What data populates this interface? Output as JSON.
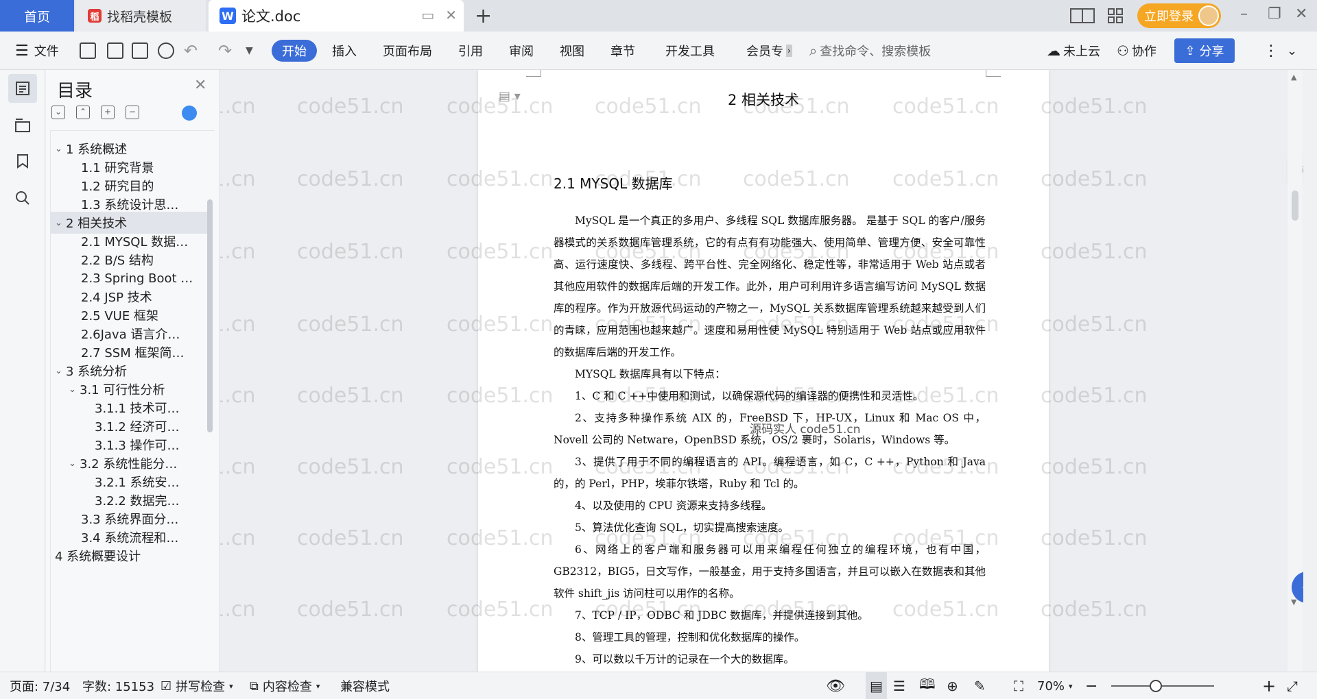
{
  "tabs": {
    "home": "首页",
    "daoke": "找稻壳模板",
    "doc": "论文.doc",
    "login": "立即登录"
  },
  "toolbar": {
    "file": "文件",
    "start": "开始",
    "insert": "插入",
    "layout": "页面布局",
    "reference": "引用",
    "review": "审阅",
    "view": "视图",
    "chapter": "章节",
    "devtools": "开发工具",
    "member": "会员专",
    "search_placeholder": "查找命令、搜索模板",
    "cloud": "未上云",
    "collab": "协作",
    "share": "分享"
  },
  "toc": {
    "title": "目录",
    "items": [
      {
        "label": "1 系统概述",
        "level": 1,
        "expanded": true
      },
      {
        "label": "1.1 研究背景",
        "level": 2
      },
      {
        "label": "1.2 研究目的",
        "level": 2
      },
      {
        "label": "1.3 系统设计思…",
        "level": 2
      },
      {
        "label": "2 相关技术",
        "level": 1,
        "expanded": true,
        "active": true
      },
      {
        "label": "2.1 MYSQL 数据…",
        "level": 2
      },
      {
        "label": "2.2 B/S 结构",
        "level": 2
      },
      {
        "label": "2.3 Spring Boot …",
        "level": 2
      },
      {
        "label": "2.4 JSP 技术",
        "level": 2
      },
      {
        "label": "2.5 VUE 框架",
        "level": 2
      },
      {
        "label": "2.6Java 语言介…",
        "level": 2
      },
      {
        "label": "2.7 SSM 框架简…",
        "level": 2
      },
      {
        "label": "3 系统分析",
        "level": 1,
        "expanded": true
      },
      {
        "label": "3.1 可行性分析",
        "level": 2,
        "expanded": true
      },
      {
        "label": "3.1.1 技术可…",
        "level": 3
      },
      {
        "label": "3.1.2 经济可…",
        "level": 3
      },
      {
        "label": "3.1.3 操作可…",
        "level": 3
      },
      {
        "label": "3.2 系统性能分…",
        "level": 2,
        "expanded": true
      },
      {
        "label": "3.2.1 系统安…",
        "level": 3
      },
      {
        "label": "3.2.2 数据完…",
        "level": 3
      },
      {
        "label": "3.3 系统界面分…",
        "level": 2
      },
      {
        "label": "3.4 系统流程和…",
        "level": 2
      },
      {
        "label": "4 系统概要设计",
        "level": 1
      }
    ]
  },
  "document": {
    "chapter_title": "2 相关技术",
    "section_title": "2.1 MYSQL 数据库",
    "intro": "MySQL 是一个真正的多用户、多线程 SQL 数据库服务器。 是基于 SQL 的客户/服务器模式的关系数据库管理系统，它的有点有有功能强大、使用简单、管理方便、安全可靠性高、运行速度快、多线程、跨平台性、完全网络化、稳定性等，非常适用于 Web 站点或者其他应用软件的数据库后端的开发工作。此外，用户可利用许多语言编写访问 MySQL 数据库的程序。作为开放源代码运动的产物之一，MySQL 关系数据库管理系统越来越受到人们的青睐，应用范围也越来越广。速度和易用性使 MySQL 特别适用于 Web 站点或应用软件的数据库后端的开发工作。",
    "features_lead": "MYSQL 数据库具有以下特点：",
    "features": [
      "1、C 和 C ++中使用和测试，以确保源代码的编译器的便携性和灵活性。",
      "2、支持多种操作系统 AIX 的，FreeBSD 下，HP-UX，Linux 和 Mac OS 中，Novell 公司的 Netware，OpenBSD 系统，OS/2 裹时，Solaris，Windows 等。",
      "3、提供了用于不同的编程语言的 API。编程语言，如 C，C ++，Python 和 Java 的，的 Perl，PHP，埃菲尔铁塔，Ruby 和 Tcl 的。",
      "4、以及使用的 CPU 资源来支持多线程。",
      "5、算法优化查询 SQL，切实提高搜索速度。",
      "6、网络上的客户端和服务器可以用来编程任何独立的编程环境，也有中国，GB2312，BIG5，日文写作，一般基金，用于支持多国语言，并且可以嵌入在数据表和其他软件 shift_jis 访问柱可以用作的名称。",
      "7、TCP / IP，ODBC 和 JDBC 数据库，并提供连接到其他。",
      "8、管理工具的管理，控制和优化数据库的操作。",
      "9、可以数以千万计的记录在一个大的数据库。"
    ],
    "overlay_tag": "源码实人  code51.cn",
    "watermark": "code51.cn"
  },
  "status": {
    "page": "页面: 7/34",
    "words": "字数: 15153",
    "spell": "拼写检查",
    "content_check": "内容检查",
    "compat": "兼容模式",
    "zoom": "70%"
  }
}
